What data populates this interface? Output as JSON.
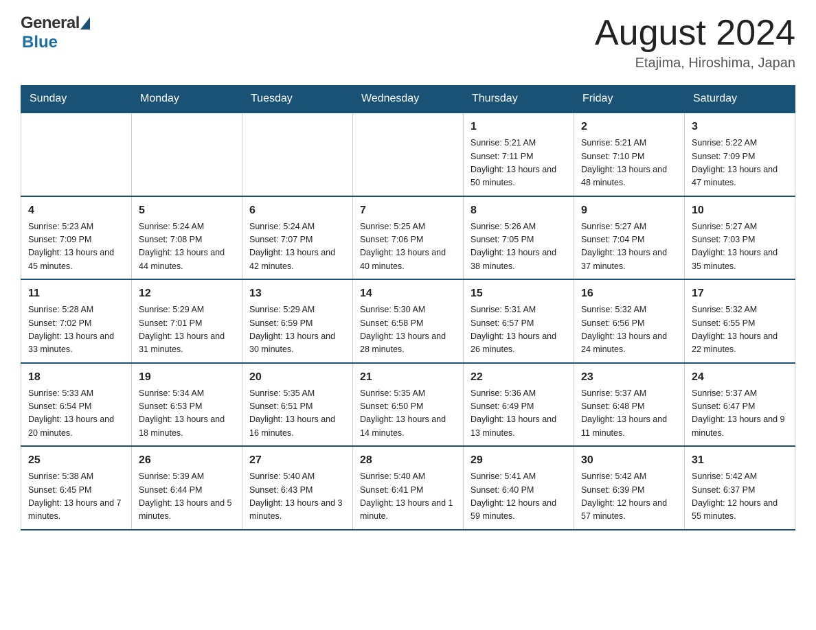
{
  "header": {
    "logo_general": "General",
    "logo_blue": "Blue",
    "month_title": "August 2024",
    "location": "Etajima, Hiroshima, Japan"
  },
  "weekdays": [
    "Sunday",
    "Monday",
    "Tuesday",
    "Wednesday",
    "Thursday",
    "Friday",
    "Saturday"
  ],
  "weeks": [
    {
      "days": [
        {
          "num": "",
          "info": ""
        },
        {
          "num": "",
          "info": ""
        },
        {
          "num": "",
          "info": ""
        },
        {
          "num": "",
          "info": ""
        },
        {
          "num": "1",
          "info": "Sunrise: 5:21 AM\nSunset: 7:11 PM\nDaylight: 13 hours\nand 50 minutes."
        },
        {
          "num": "2",
          "info": "Sunrise: 5:21 AM\nSunset: 7:10 PM\nDaylight: 13 hours\nand 48 minutes."
        },
        {
          "num": "3",
          "info": "Sunrise: 5:22 AM\nSunset: 7:09 PM\nDaylight: 13 hours\nand 47 minutes."
        }
      ]
    },
    {
      "days": [
        {
          "num": "4",
          "info": "Sunrise: 5:23 AM\nSunset: 7:09 PM\nDaylight: 13 hours\nand 45 minutes."
        },
        {
          "num": "5",
          "info": "Sunrise: 5:24 AM\nSunset: 7:08 PM\nDaylight: 13 hours\nand 44 minutes."
        },
        {
          "num": "6",
          "info": "Sunrise: 5:24 AM\nSunset: 7:07 PM\nDaylight: 13 hours\nand 42 minutes."
        },
        {
          "num": "7",
          "info": "Sunrise: 5:25 AM\nSunset: 7:06 PM\nDaylight: 13 hours\nand 40 minutes."
        },
        {
          "num": "8",
          "info": "Sunrise: 5:26 AM\nSunset: 7:05 PM\nDaylight: 13 hours\nand 38 minutes."
        },
        {
          "num": "9",
          "info": "Sunrise: 5:27 AM\nSunset: 7:04 PM\nDaylight: 13 hours\nand 37 minutes."
        },
        {
          "num": "10",
          "info": "Sunrise: 5:27 AM\nSunset: 7:03 PM\nDaylight: 13 hours\nand 35 minutes."
        }
      ]
    },
    {
      "days": [
        {
          "num": "11",
          "info": "Sunrise: 5:28 AM\nSunset: 7:02 PM\nDaylight: 13 hours\nand 33 minutes."
        },
        {
          "num": "12",
          "info": "Sunrise: 5:29 AM\nSunset: 7:01 PM\nDaylight: 13 hours\nand 31 minutes."
        },
        {
          "num": "13",
          "info": "Sunrise: 5:29 AM\nSunset: 6:59 PM\nDaylight: 13 hours\nand 30 minutes."
        },
        {
          "num": "14",
          "info": "Sunrise: 5:30 AM\nSunset: 6:58 PM\nDaylight: 13 hours\nand 28 minutes."
        },
        {
          "num": "15",
          "info": "Sunrise: 5:31 AM\nSunset: 6:57 PM\nDaylight: 13 hours\nand 26 minutes."
        },
        {
          "num": "16",
          "info": "Sunrise: 5:32 AM\nSunset: 6:56 PM\nDaylight: 13 hours\nand 24 minutes."
        },
        {
          "num": "17",
          "info": "Sunrise: 5:32 AM\nSunset: 6:55 PM\nDaylight: 13 hours\nand 22 minutes."
        }
      ]
    },
    {
      "days": [
        {
          "num": "18",
          "info": "Sunrise: 5:33 AM\nSunset: 6:54 PM\nDaylight: 13 hours\nand 20 minutes."
        },
        {
          "num": "19",
          "info": "Sunrise: 5:34 AM\nSunset: 6:53 PM\nDaylight: 13 hours\nand 18 minutes."
        },
        {
          "num": "20",
          "info": "Sunrise: 5:35 AM\nSunset: 6:51 PM\nDaylight: 13 hours\nand 16 minutes."
        },
        {
          "num": "21",
          "info": "Sunrise: 5:35 AM\nSunset: 6:50 PM\nDaylight: 13 hours\nand 14 minutes."
        },
        {
          "num": "22",
          "info": "Sunrise: 5:36 AM\nSunset: 6:49 PM\nDaylight: 13 hours\nand 13 minutes."
        },
        {
          "num": "23",
          "info": "Sunrise: 5:37 AM\nSunset: 6:48 PM\nDaylight: 13 hours\nand 11 minutes."
        },
        {
          "num": "24",
          "info": "Sunrise: 5:37 AM\nSunset: 6:47 PM\nDaylight: 13 hours\nand 9 minutes."
        }
      ]
    },
    {
      "days": [
        {
          "num": "25",
          "info": "Sunrise: 5:38 AM\nSunset: 6:45 PM\nDaylight: 13 hours\nand 7 minutes."
        },
        {
          "num": "26",
          "info": "Sunrise: 5:39 AM\nSunset: 6:44 PM\nDaylight: 13 hours\nand 5 minutes."
        },
        {
          "num": "27",
          "info": "Sunrise: 5:40 AM\nSunset: 6:43 PM\nDaylight: 13 hours\nand 3 minutes."
        },
        {
          "num": "28",
          "info": "Sunrise: 5:40 AM\nSunset: 6:41 PM\nDaylight: 13 hours\nand 1 minute."
        },
        {
          "num": "29",
          "info": "Sunrise: 5:41 AM\nSunset: 6:40 PM\nDaylight: 12 hours\nand 59 minutes."
        },
        {
          "num": "30",
          "info": "Sunrise: 5:42 AM\nSunset: 6:39 PM\nDaylight: 12 hours\nand 57 minutes."
        },
        {
          "num": "31",
          "info": "Sunrise: 5:42 AM\nSunset: 6:37 PM\nDaylight: 12 hours\nand 55 minutes."
        }
      ]
    }
  ]
}
